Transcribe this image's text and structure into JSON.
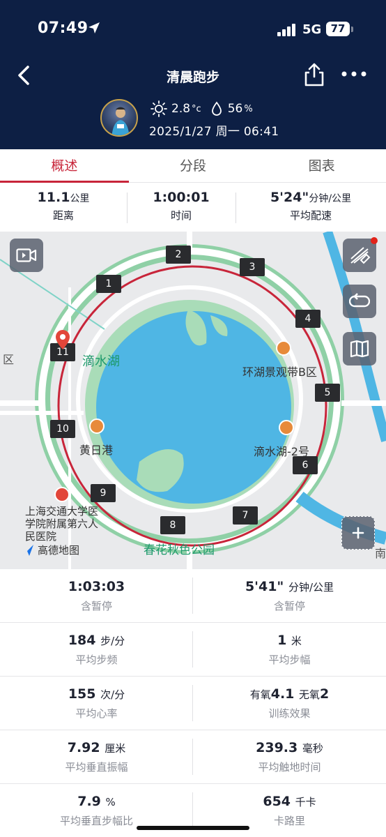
{
  "status_bar": {
    "time": "07:49",
    "network": "5G",
    "battery": "77"
  },
  "header": {
    "title": "清晨跑步",
    "temperature": "2.8",
    "temperature_unit": "°c",
    "humidity": "56",
    "humidity_unit": "%",
    "datetime": "2025/1/27 周一 06:41"
  },
  "tabs": [
    {
      "label": "概述",
      "active": true
    },
    {
      "label": "分段",
      "active": false
    },
    {
      "label": "图表",
      "active": false
    }
  ],
  "summary": {
    "distance": {
      "value": "11.1",
      "unit": "公里",
      "label": "距离"
    },
    "time": {
      "value": "1:00:01",
      "label": "时间"
    },
    "pace": {
      "value": "5'24\"",
      "unit": "分钟/公里",
      "label": "平均配速"
    }
  },
  "map": {
    "lake_name": "滴水湖",
    "poi_1": "环湖景观带B区",
    "poi_2": "黄日港",
    "poi_3": "滴水湖-2号",
    "park": "春花秋色公园",
    "hospital": "上海交通大学医学院附属第六人民医院",
    "edge_left": "区",
    "edge_right": "南",
    "provider": "高德地图",
    "km_markers": [
      "1",
      "2",
      "3",
      "4",
      "5",
      "6",
      "7",
      "8",
      "9",
      "10",
      "11"
    ],
    "colors": {
      "route": "#c8253a",
      "water": "#4fb6e4",
      "park": "#8fd0a6",
      "road": "#ffffff"
    }
  },
  "details": {
    "total_time": {
      "value": "1:03:03",
      "label": "含暂停"
    },
    "total_pace": {
      "value": "5'41\"",
      "unit": "分钟/公里",
      "label": "含暂停"
    },
    "cadence": {
      "value": "184",
      "unit": "步/分",
      "label": "平均步频"
    },
    "stride": {
      "value": "1",
      "unit": "米",
      "label": "平均步幅"
    },
    "heart_rate": {
      "value": "155",
      "unit": "次/分",
      "label": "平均心率"
    },
    "training_effect": {
      "aerobic_label": "有氧",
      "aerobic": "4.1",
      "anaerobic_label": "无氧",
      "anaerobic": "2",
      "label": "训练效果"
    },
    "vertical_osc": {
      "value": "7.92",
      "unit": "厘米",
      "label": "平均垂直振幅"
    },
    "ground_contact": {
      "value": "239.3",
      "unit": "毫秒",
      "label": "平均触地时间"
    },
    "vertical_ratio": {
      "value": "7.9",
      "unit": "%",
      "label": "平均垂直步幅比"
    },
    "calories": {
      "value": "654",
      "unit": "千卡",
      "label": "卡路里"
    }
  },
  "theme": {
    "header_bg": "#0d1f44",
    "accent": "#c8253a"
  }
}
